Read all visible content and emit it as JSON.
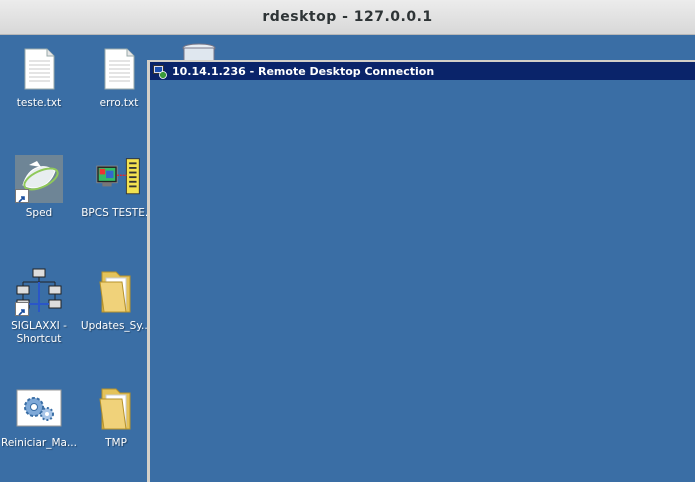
{
  "window": {
    "title": "rdesktop - 127.0.0.1"
  },
  "remote_window": {
    "title": "10.14.1.236 - Remote Desktop Connection",
    "icon": "remote-desktop-icon"
  },
  "desktop": {
    "icons": [
      {
        "label": "teste.txt",
        "icon": "text-file-icon"
      },
      {
        "label": "erro.txt",
        "icon": "text-file-icon"
      },
      {
        "label": "Sped",
        "icon": "sped-app-icon"
      },
      {
        "label": "BPCS TESTE.w",
        "icon": "bpcs-app-icon"
      },
      {
        "label": "SIGLAXXI -\nShortcut",
        "icon": "network-icon"
      },
      {
        "label": "Updates_Sy...",
        "icon": "folder-icon"
      },
      {
        "label": "Reiniciar_Ma...",
        "icon": "settings-gears-icon"
      },
      {
        "label": "TMP",
        "icon": "folder-icon"
      }
    ],
    "recycle_bin_icon": "recycle-bin-icon"
  },
  "colors": {
    "desktop_bg": "#3a6ea5",
    "remote_titlebar": "#0a246a",
    "host_titlebar": "#e0e0e0"
  }
}
